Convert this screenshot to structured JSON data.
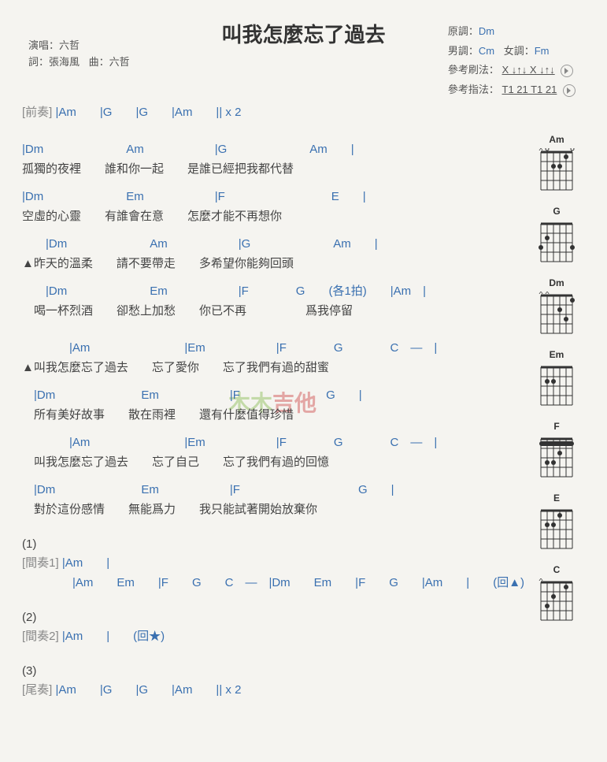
{
  "title": "叫我怎麼忘了過去",
  "meta_left": {
    "performer_label": "演唱：",
    "performer": "六哲",
    "lyricist_label": "詞：",
    "lyricist": "張海風",
    "composer_label": "曲：",
    "composer": "六哲"
  },
  "meta_right": {
    "orig_key_label": "原調：",
    "orig_key": "Dm",
    "male_key_label": "男調：",
    "male_key": "Cm",
    "female_key_label": "女調：",
    "female_key": "Fm",
    "strum_label": "參考刷法：",
    "strum_pattern": "X ↓↑↓ X ↓↑↓",
    "pick_label": "參考指法：",
    "pick_pattern": "T1 21 T1 21"
  },
  "intro": {
    "label": "[前奏]",
    "chords": "|Am　　|G　　|G　　|Am　　|| x 2"
  },
  "verse_a": [
    {
      "chords": "|Dm　　　　　　　Am　　　　　　|G　　　　　　　Am　　|",
      "lyric": "孤獨的夜裡　　誰和你一起　　是誰已經把我都代替"
    },
    {
      "chords": "|Dm　　　　　　　Em　　　　　　|F　　　　　　　　　E　　|",
      "lyric": "空虛的心靈　　有誰會在意　　怎麼才能不再想你"
    }
  ],
  "verse_b": [
    {
      "chords": "　　|Dm　　　　　　　Am　　　　　　|G　　　　　　　Am　　|",
      "lyric": "▲昨天的溫柔　　請不要帶走　　多希望你能夠回頭"
    },
    {
      "chords": "　　|Dm　　　　　　　Em　　　　　　|F　　　　G　　(各1拍)　　|Am　|",
      "lyric": "　喝一杯烈酒　　卻愁上加愁　　你已不再　　　　　爲我停留"
    }
  ],
  "chorus": [
    {
      "chords": "　　　　|Am　　　　　　　　|Em　　　　　　|F　　　　G　　　　C　—　|",
      "lyric": "▲叫我怎麼忘了過去　　忘了愛你　　忘了我們有過的甜蜜"
    },
    {
      "chords": "　|Dm　　　　　　　 Em　　　　　　|F　　　　　　　 G　　|",
      "lyric": "　所有美好故事　　散在雨裡　　還有什麼值得珍惜"
    },
    {
      "chords": "　　　　|Am　　　　　　　　|Em　　　　　　|F　　　　G　　　　C　—　|",
      "lyric": "　叫我怎麼忘了過去　　忘了自己　　忘了我們有過的回憶"
    },
    {
      "chords": "　|Dm　　　　　　　  Em　　　　　　|F　　　　　　　　　　G　　|",
      "lyric": "　對於這份感情　　無能爲力　　我只能試著開始放棄你"
    }
  ],
  "sections": [
    {
      "num": "(1)",
      "label": "[間奏1]",
      "chords_a": "|Am　　|",
      "chords_b": "|Am　　Em　　|F　　G　　C　—　|Dm　　Em　　|F　　G　　|Am　　|　　(回▲)"
    },
    {
      "num": "(2)",
      "label": "[間奏2]",
      "chords_a": "|Am　　|　　(回★)"
    },
    {
      "num": "(3)",
      "label": "[尾奏]",
      "chords_a": "|Am　　|G　　|G　　|Am　　|| x 2"
    }
  ],
  "diagrams": [
    "Am",
    "G",
    "Dm",
    "Em",
    "F",
    "E",
    "C"
  ],
  "watermark_a": "木木",
  "watermark_b": "吉他"
}
